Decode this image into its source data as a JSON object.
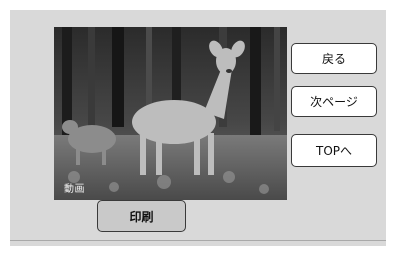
{
  "media": {
    "label": "動画",
    "subject_icon": "deer-photo"
  },
  "buttons": {
    "back": "戻る",
    "next_page": "次ページ",
    "top": "TOPへ",
    "print": "印刷"
  },
  "colors": {
    "panel_background": "#d9d9d9",
    "button_background": "#ffffff",
    "print_button_background": "#c9c9c9",
    "button_border": "#3a3a3a"
  }
}
